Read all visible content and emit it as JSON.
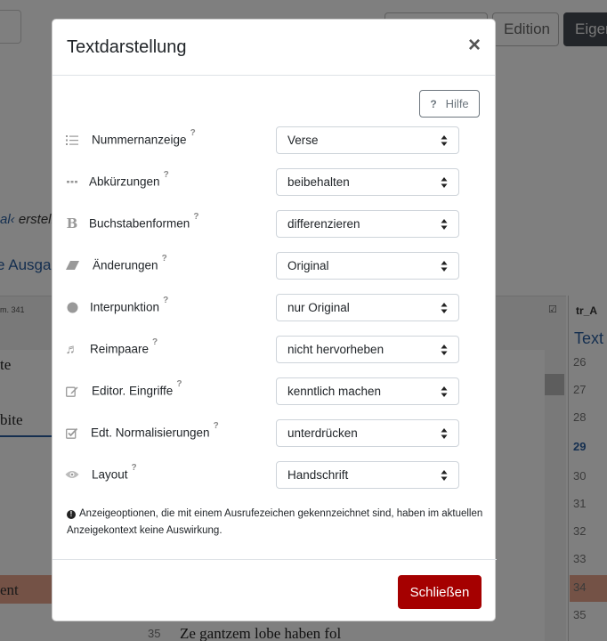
{
  "background": {
    "buttons": {
      "edition": "Edition",
      "eigen": "Eigen"
    },
    "link1_prefix": "al‹",
    "link1_suffix": " erstell",
    "link2": "e Ausgab",
    "panel_header_left": "m. 341",
    "panel_header_right": "tr_A",
    "panel_text_title": "Text",
    "left_lines": [
      "te",
      "bite",
      "ent"
    ],
    "verse_line": "Ze gantzem lobe haben fol",
    "verse_line_number": "35",
    "right_numbers": [
      "26",
      "27",
      "28",
      "29",
      "30",
      "31",
      "32",
      "33",
      "34",
      "35"
    ]
  },
  "modal": {
    "title": "Textdarstellung",
    "close_icon": "×",
    "help": {
      "icon": "?",
      "label": "Hilfe"
    },
    "rows": [
      {
        "icon": "list-numbered-icon",
        "label": "Nummernanzeige",
        "value": "Verse"
      },
      {
        "icon": "ellipsis-icon",
        "label": "Abkürzungen",
        "value": "beibehalten"
      },
      {
        "icon": "bold-b-icon",
        "label": "Buchstabenformen",
        "value": "differenzieren"
      },
      {
        "icon": "eraser-icon",
        "label": "Änderungen",
        "value": "Original"
      },
      {
        "icon": "circle-icon",
        "label": "Interpunktion",
        "value": "nur Original"
      },
      {
        "icon": "music-note-icon",
        "label": "Reimpaare",
        "value": "nicht hervorheben"
      },
      {
        "icon": "edit-icon",
        "label": "Editor. Eingriffe",
        "value": "kenntlich machen"
      },
      {
        "icon": "check-square-icon",
        "label": "Edt. Normalisierungen",
        "value": "unterdrücken"
      },
      {
        "icon": "eye-icon",
        "label": "Layout",
        "value": "Handschrift"
      }
    ],
    "help_marker": "?",
    "note": "Anzeigeoptionen, die mit einem Ausrufezeichen gekennzeichnet sind, haben im aktuellen Anzeigekontext keine Auswirkung.",
    "note_icon": "!",
    "footer_button": "Schließen"
  },
  "colors": {
    "primary_button": "#a50000",
    "overlay": "rgba(0,0,0,0.5)"
  }
}
